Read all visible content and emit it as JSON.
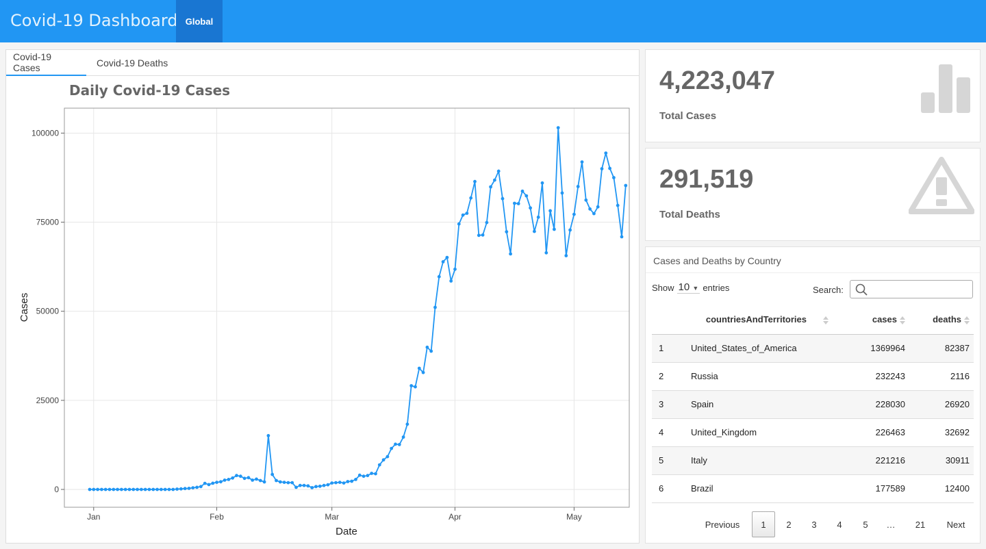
{
  "header": {
    "title": "Covid-19 Dashboard",
    "nav_tab": "Global"
  },
  "tabs": [
    {
      "label": "Covid-19 Cases",
      "active": true
    },
    {
      "label": "Covid-19 Deaths",
      "active": false
    }
  ],
  "colors": {
    "accent": "#2196f3",
    "accent_dark": "#1976d2",
    "line": "#2196f3",
    "icon_gray": "#d6d6d6"
  },
  "chart_data": {
    "type": "line",
    "title": "Daily Covid-19 Cases",
    "xlabel": "Date",
    "ylabel": "Cases",
    "x_start": "2019-12-31",
    "x_end": "2020-05-13",
    "x_ticks": [
      {
        "label": "Jan",
        "date": "2020-01-01"
      },
      {
        "label": "Feb",
        "date": "2020-02-01"
      },
      {
        "label": "Mar",
        "date": "2020-03-01"
      },
      {
        "label": "Apr",
        "date": "2020-04-01"
      },
      {
        "label": "May",
        "date": "2020-05-01"
      }
    ],
    "y_ticks": [
      "0",
      "25000",
      "50000",
      "75000",
      "100000"
    ],
    "ylim": [
      -5000,
      107000
    ],
    "grid": true,
    "series": [
      {
        "values": [
          0,
          0,
          0,
          0,
          0,
          0,
          0,
          0,
          0,
          0,
          0,
          0,
          0,
          0,
          0,
          0,
          0,
          0,
          0,
          0,
          0,
          0,
          100,
          150,
          250,
          300,
          450,
          600,
          800,
          1700,
          1350,
          1750,
          2000,
          2150,
          2600,
          2800,
          3200,
          3900,
          3700,
          3100,
          3300,
          2600,
          2900,
          2500,
          2100,
          15100,
          4200,
          2500,
          2100,
          2000,
          1900,
          1900,
          600,
          1100,
          1100,
          1000,
          500,
          800,
          900,
          1100,
          1300,
          1800,
          1900,
          2000,
          1800,
          2200,
          2300,
          2800,
          4000,
          3700,
          3900,
          4500,
          4400,
          6900,
          8300,
          9200,
          11500,
          12700,
          12600,
          14700,
          18300,
          29100,
          28800,
          34000,
          32800,
          39900,
          38800,
          51100,
          59700,
          63900,
          65100,
          58500,
          61800,
          74500,
          77000,
          77500,
          81800,
          86400,
          71300,
          71400,
          74900,
          84900,
          86800,
          89300,
          81600,
          72300,
          66100,
          80300,
          80200,
          83700,
          82400,
          79000,
          72400,
          76400,
          86000,
          66400,
          78200,
          73000,
          101500,
          83200,
          65600,
          72800,
          77200,
          85000,
          91900,
          81200,
          78700,
          77400,
          79300,
          90000,
          94400,
          90100,
          87500,
          79700,
          70900,
          85300
        ]
      }
    ]
  },
  "stats": {
    "total_cases": {
      "value": "4,223,047",
      "label": "Total Cases",
      "icon": "bar-chart-icon"
    },
    "total_deaths": {
      "value": "291,519",
      "label": "Total Deaths",
      "icon": "warning-icon"
    }
  },
  "table": {
    "title": "Cases and Deaths by Country",
    "show_label": "Show",
    "page_size": "10",
    "entries_label": "entries",
    "search_label": "Search:",
    "search_value": "",
    "columns": [
      "",
      "countriesAndTerritories",
      "cases",
      "deaths"
    ],
    "rows": [
      [
        "1",
        "United_States_of_America",
        "1369964",
        "82387"
      ],
      [
        "2",
        "Russia",
        "232243",
        "2116"
      ],
      [
        "3",
        "Spain",
        "228030",
        "26920"
      ],
      [
        "4",
        "United_Kingdom",
        "226463",
        "32692"
      ],
      [
        "5",
        "Italy",
        "221216",
        "30911"
      ],
      [
        "6",
        "Brazil",
        "177589",
        "12400"
      ]
    ],
    "pagination": {
      "previous": "Previous",
      "pages": [
        "1",
        "2",
        "3",
        "4",
        "5",
        "…",
        "21"
      ],
      "current": "1",
      "next": "Next"
    }
  }
}
